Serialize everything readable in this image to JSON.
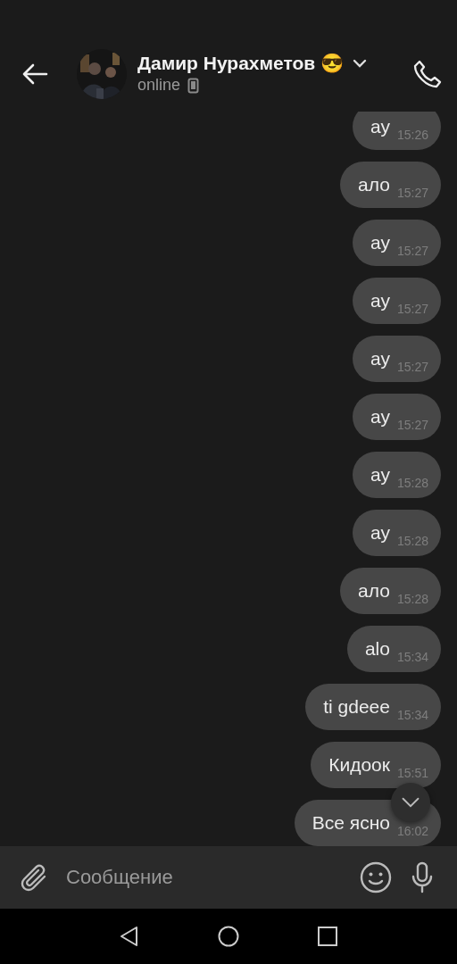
{
  "header": {
    "name": "Дамир Нурахметов 😎",
    "status": "online"
  },
  "messages": [
    {
      "text": "ау",
      "time": "15:26"
    },
    {
      "text": "ало",
      "time": "15:27"
    },
    {
      "text": "ау",
      "time": "15:27"
    },
    {
      "text": "ау",
      "time": "15:27"
    },
    {
      "text": "ау",
      "time": "15:27"
    },
    {
      "text": "ау",
      "time": "15:27"
    },
    {
      "text": "ау",
      "time": "15:28"
    },
    {
      "text": "ау",
      "time": "15:28"
    },
    {
      "text": "ало",
      "time": "15:28"
    },
    {
      "text": "alo",
      "time": "15:34"
    },
    {
      "text": "ti gdeee",
      "time": "15:34"
    },
    {
      "text": "Кидоок",
      "time": "15:51"
    },
    {
      "text": "Все ясно",
      "time": "16:02"
    }
  ],
  "composer": {
    "placeholder": "Сообщение"
  }
}
